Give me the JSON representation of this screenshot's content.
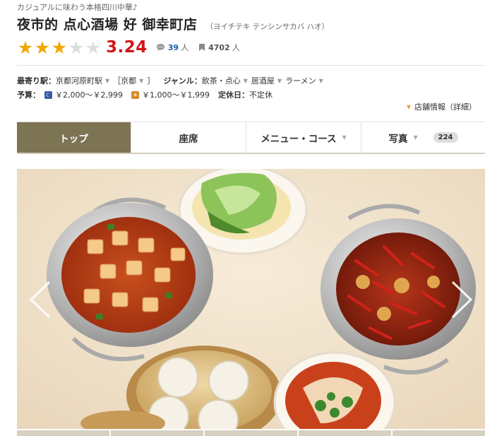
{
  "header": {
    "catchphrase": "カジュアルに味わう本格四川中華♪",
    "shop_name": "夜市的 点心酒場 好 御幸町店",
    "kana": "（ヨイチテキ テンシンサカバ ハオ）"
  },
  "rating": {
    "stars": 3,
    "max_stars": 5,
    "score": "3.24",
    "reviews_count": "39",
    "reviews_unit": "人",
    "saves_count": "4702",
    "saves_unit": "人"
  },
  "info": {
    "station_label": "最寄り駅：",
    "station_value": "京都河原町駅",
    "area_open": "［",
    "area_value": "京都",
    "area_close": "］",
    "genre_label": "ジャンル：",
    "genres": [
      "飲茶・点心",
      "居酒屋",
      "ラーメン"
    ],
    "budget_label": "予算：",
    "budget_dinner": "￥2,000～￥2,999",
    "budget_lunch": "￥1,000～￥1,999",
    "holiday_label": "定休日：",
    "holiday_value": "不定休",
    "shop_info_link": "店舗情報（詳細）"
  },
  "tabs": [
    {
      "label": "トップ",
      "active": true
    },
    {
      "label": "座席",
      "active": false
    },
    {
      "label": "メニュー・コース",
      "active": false
    },
    {
      "label": "写真",
      "active": false,
      "count": "224"
    }
  ],
  "colors": {
    "star_on": "#f0a800",
    "score": "#d0161a",
    "active_tab": "#7d7454",
    "link": "#1d5aa8"
  },
  "icons": {
    "review": "speech-bubble-icon",
    "save": "bookmark-icon",
    "dinner": "moon-icon",
    "lunch": "sun-icon",
    "prev": "chevron-left-icon",
    "next": "chevron-right-icon"
  }
}
